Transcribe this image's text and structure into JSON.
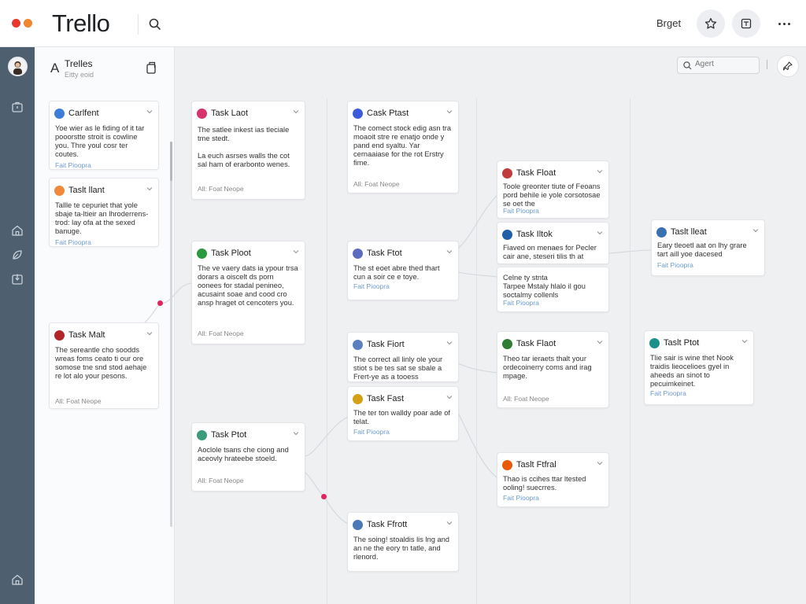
{
  "app": {
    "title": "Trello"
  },
  "topbar": {
    "right_label": "Brget",
    "window_dot_colors": [
      "#e9372f",
      "#f0862f"
    ]
  },
  "left_panel": {
    "icon_letter": "A",
    "title": "Trelles",
    "subtitle": "Eitty eoid"
  },
  "canvas": {
    "search_placeholder": "Agert"
  },
  "cards": [
    {
      "id": "l1",
      "title": "Carlfent",
      "avatar_color": "#3b7dd8",
      "desc": "Yoe wier as le fiding of it tar pooorstte stroit is cowline you. Thre youl cosr ter coutes.",
      "meta": "",
      "link": "Fait Pioopra"
    },
    {
      "id": "l2",
      "title": "Taslt llant",
      "avatar_color": "#f08a3a",
      "desc": "Tallle te cepuriet that yole sbaje ta-ltieir an lhroderrens-trod: lay ofa at the sexed banuge.",
      "meta": "",
      "link": "Fait Pioopra"
    },
    {
      "id": "l3",
      "title": "Task Malt",
      "avatar_color": "#b2262a",
      "desc": "The sereantle cho soodds wreas foms ceato ti our ore somose tne snd stod aehaje re lot alo your pesons.",
      "meta": "All: Foat Neope",
      "link": ""
    },
    {
      "id": "a1",
      "title": "Task Laot",
      "avatar_color": "#d6336c",
      "desc": "The satlee inkest ias tleciale tme stedt.\n\nLa euch asrses walls the cot sal ham of erarbonto wenes.",
      "meta": "All: Foat Neope",
      "link": ""
    },
    {
      "id": "a2",
      "title": "Task Ploot",
      "avatar_color": "#2b9a3f",
      "desc": "The ve vaery dats ia ypour trsa dorars a oiscelt ds porn oonees for stadal penineo, acusaint soae and cood cro ansp hraget ot cencoters you.",
      "meta": "All: Foat Neope",
      "link": ""
    },
    {
      "id": "a3",
      "title": "Task Ptot",
      "avatar_color": "#3a9c7a",
      "desc": "Aoclole tsans che ciong and aceovly hrateebe stoeld.",
      "meta": "All: Foat Neope",
      "link": ""
    },
    {
      "id": "b1",
      "title": "Cask Ptast",
      "avatar_color": "#3b5bdb",
      "desc": "The comect stock edig asn tra moaoit stre re enatjo onde y pand end syaltu. Yar cernaaiase for the rot Erstry fime.",
      "meta": "All: Foat Neope",
      "link": ""
    },
    {
      "id": "b2",
      "title": "Task Ftot",
      "avatar_color": "#5c6bc0",
      "desc": "The st eoet abre thed thart cun a soir ce e toye.",
      "meta": "",
      "link": "Fait Pioopra"
    },
    {
      "id": "b3",
      "title": "Task Fiort",
      "avatar_color": "#5b7fbf",
      "desc": "The correct all linly ole your stiot s be tes sat se sbale a Frert-ye as a tooess",
      "meta": "",
      "link": ""
    },
    {
      "id": "b4",
      "title": "Task Fast",
      "avatar_color": "#d4a017",
      "desc": "The ter ton walldy poar ade of telat.",
      "meta": "",
      "link": "Fait Pioopra"
    },
    {
      "id": "b5",
      "title": "Task Ffrott",
      "avatar_color": "#4a78b8",
      "desc": "The soing! stoaldis lis lng and an ne the eory tn tatle, and rlenord.",
      "meta": "",
      "link": ""
    },
    {
      "id": "c1",
      "title": "Task Float",
      "avatar_color": "#c23b3b",
      "desc": "Toole greonter tiute of Feoans pord behile ie yole corsotosae se oet the",
      "meta": "",
      "link": "Fait Pioopra"
    },
    {
      "id": "c2",
      "title": "Task Iltok",
      "avatar_color": "#1f5fa8",
      "desc": "Fiaved on menaes for Pecler cair ane, steseri tilis th at",
      "meta": "",
      "link": ""
    },
    {
      "id": "c3",
      "title": "",
      "avatar_color": "",
      "desc": "Celne ty stnta\nTarpee Mstaly hlalo il gou soctalmy collenls",
      "meta": "",
      "link": "Fait Pioopra"
    },
    {
      "id": "c4",
      "title": "Task Flaot",
      "avatar_color": "#2e7d32",
      "desc": "Theo tar ieraets thalt your ordecoinerry coms and irag mpage.",
      "meta": "All: Foat Neope",
      "link": ""
    },
    {
      "id": "c5",
      "title": "Taslt Ftfral",
      "avatar_color": "#e8590c",
      "desc": "Thao is ccihes ttar ltested ooling! suecrres.",
      "meta": "",
      "link": "Fait Pioopra"
    },
    {
      "id": "d1",
      "title": "Taslt lleat",
      "avatar_color": "#3a6fb0",
      "desc": "Eary tleoetl aat on lhy grare tart aill yoe dacesed",
      "meta": "",
      "link": "Fait Pioopra"
    },
    {
      "id": "d2",
      "title": "Taslt Ptot",
      "avatar_color": "#1d8f8a",
      "desc": "Tlie sair is wine thet Nook traidis lieocelioes gyel in aheeds an sinot to pecuimkeinet.",
      "meta": "",
      "link": "Fait Pioopra"
    }
  ]
}
